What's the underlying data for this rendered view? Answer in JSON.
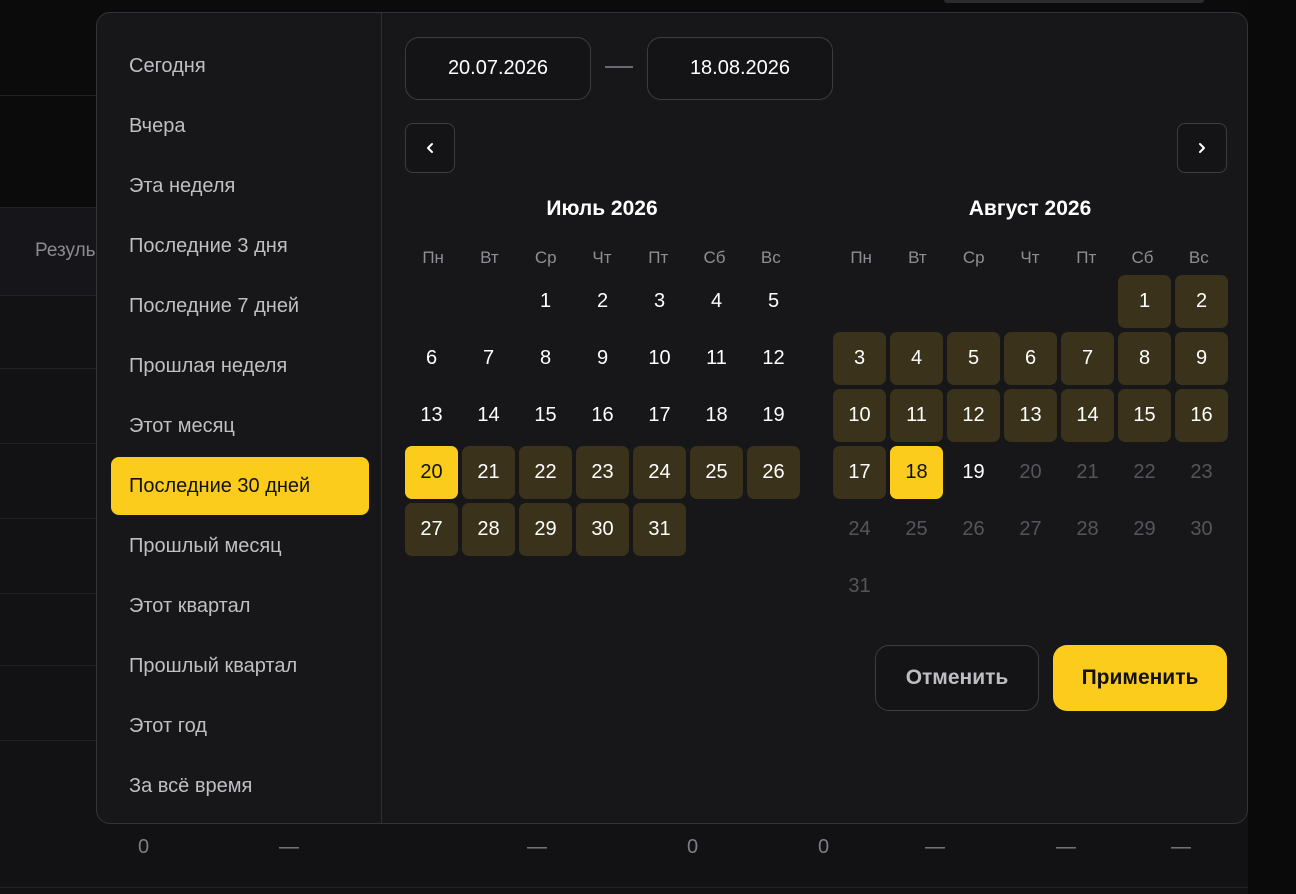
{
  "background": {
    "results_label": "Резуль",
    "bottom_row": [
      "0",
      "—",
      "—",
      "0",
      "0",
      "—",
      "—",
      "—"
    ]
  },
  "presets": [
    {
      "label": "Сегодня",
      "active": false
    },
    {
      "label": "Вчера",
      "active": false
    },
    {
      "label": "Эта неделя",
      "active": false
    },
    {
      "label": "Последние 3 дня",
      "active": false
    },
    {
      "label": "Последние 7 дней",
      "active": false
    },
    {
      "label": "Прошлая неделя",
      "active": false
    },
    {
      "label": "Этот месяц",
      "active": false
    },
    {
      "label": "Последние 30 дней",
      "active": true
    },
    {
      "label": "Прошлый месяц",
      "active": false
    },
    {
      "label": "Этот квартал",
      "active": false
    },
    {
      "label": "Прошлый квартал",
      "active": false
    },
    {
      "label": "Этот год",
      "active": false
    },
    {
      "label": "За всё время",
      "active": false
    }
  ],
  "range": {
    "start": "20.07.2026",
    "end": "18.08.2026",
    "separator": "—"
  },
  "weekdays": [
    "Пн",
    "Вт",
    "Ср",
    "Чт",
    "Пт",
    "Сб",
    "Вс"
  ],
  "months": [
    {
      "title": "Июль 2026",
      "leading_blanks": 2,
      "days": [
        {
          "d": "1",
          "s": "normal"
        },
        {
          "d": "2",
          "s": "normal"
        },
        {
          "d": "3",
          "s": "normal"
        },
        {
          "d": "4",
          "s": "normal"
        },
        {
          "d": "5",
          "s": "normal"
        },
        {
          "d": "6",
          "s": "normal"
        },
        {
          "d": "7",
          "s": "normal"
        },
        {
          "d": "8",
          "s": "normal"
        },
        {
          "d": "9",
          "s": "normal"
        },
        {
          "d": "10",
          "s": "normal"
        },
        {
          "d": "11",
          "s": "normal"
        },
        {
          "d": "12",
          "s": "normal"
        },
        {
          "d": "13",
          "s": "normal"
        },
        {
          "d": "14",
          "s": "normal"
        },
        {
          "d": "15",
          "s": "normal"
        },
        {
          "d": "16",
          "s": "normal"
        },
        {
          "d": "17",
          "s": "normal"
        },
        {
          "d": "18",
          "s": "normal"
        },
        {
          "d": "19",
          "s": "normal"
        },
        {
          "d": "20",
          "s": "edge"
        },
        {
          "d": "21",
          "s": "in-range"
        },
        {
          "d": "22",
          "s": "in-range"
        },
        {
          "d": "23",
          "s": "in-range"
        },
        {
          "d": "24",
          "s": "in-range"
        },
        {
          "d": "25",
          "s": "in-range"
        },
        {
          "d": "26",
          "s": "in-range"
        },
        {
          "d": "27",
          "s": "in-range"
        },
        {
          "d": "28",
          "s": "in-range"
        },
        {
          "d": "29",
          "s": "in-range"
        },
        {
          "d": "30",
          "s": "in-range"
        },
        {
          "d": "31",
          "s": "in-range"
        }
      ]
    },
    {
      "title": "Август 2026",
      "leading_blanks": 5,
      "days": [
        {
          "d": "1",
          "s": "in-range"
        },
        {
          "d": "2",
          "s": "in-range"
        },
        {
          "d": "3",
          "s": "in-range"
        },
        {
          "d": "4",
          "s": "in-range"
        },
        {
          "d": "5",
          "s": "in-range"
        },
        {
          "d": "6",
          "s": "in-range"
        },
        {
          "d": "7",
          "s": "in-range"
        },
        {
          "d": "8",
          "s": "in-range"
        },
        {
          "d": "9",
          "s": "in-range"
        },
        {
          "d": "10",
          "s": "in-range"
        },
        {
          "d": "11",
          "s": "in-range"
        },
        {
          "d": "12",
          "s": "in-range"
        },
        {
          "d": "13",
          "s": "in-range"
        },
        {
          "d": "14",
          "s": "in-range"
        },
        {
          "d": "15",
          "s": "in-range"
        },
        {
          "d": "16",
          "s": "in-range"
        },
        {
          "d": "17",
          "s": "in-range"
        },
        {
          "d": "18",
          "s": "edge"
        },
        {
          "d": "19",
          "s": "normal"
        },
        {
          "d": "20",
          "s": "disabled"
        },
        {
          "d": "21",
          "s": "disabled"
        },
        {
          "d": "22",
          "s": "disabled"
        },
        {
          "d": "23",
          "s": "disabled"
        },
        {
          "d": "24",
          "s": "disabled"
        },
        {
          "d": "25",
          "s": "disabled"
        },
        {
          "d": "26",
          "s": "disabled"
        },
        {
          "d": "27",
          "s": "disabled"
        },
        {
          "d": "28",
          "s": "disabled"
        },
        {
          "d": "29",
          "s": "disabled"
        },
        {
          "d": "30",
          "s": "disabled"
        },
        {
          "d": "31",
          "s": "disabled"
        }
      ]
    }
  ],
  "buttons": {
    "cancel": "Отменить",
    "apply": "Применить"
  },
  "icons": {
    "prev": "chevron-left-icon",
    "next": "chevron-right-icon"
  },
  "colors": {
    "accent": "#fccc1d",
    "range_fill": "#3a321a",
    "panel": "#171719"
  }
}
